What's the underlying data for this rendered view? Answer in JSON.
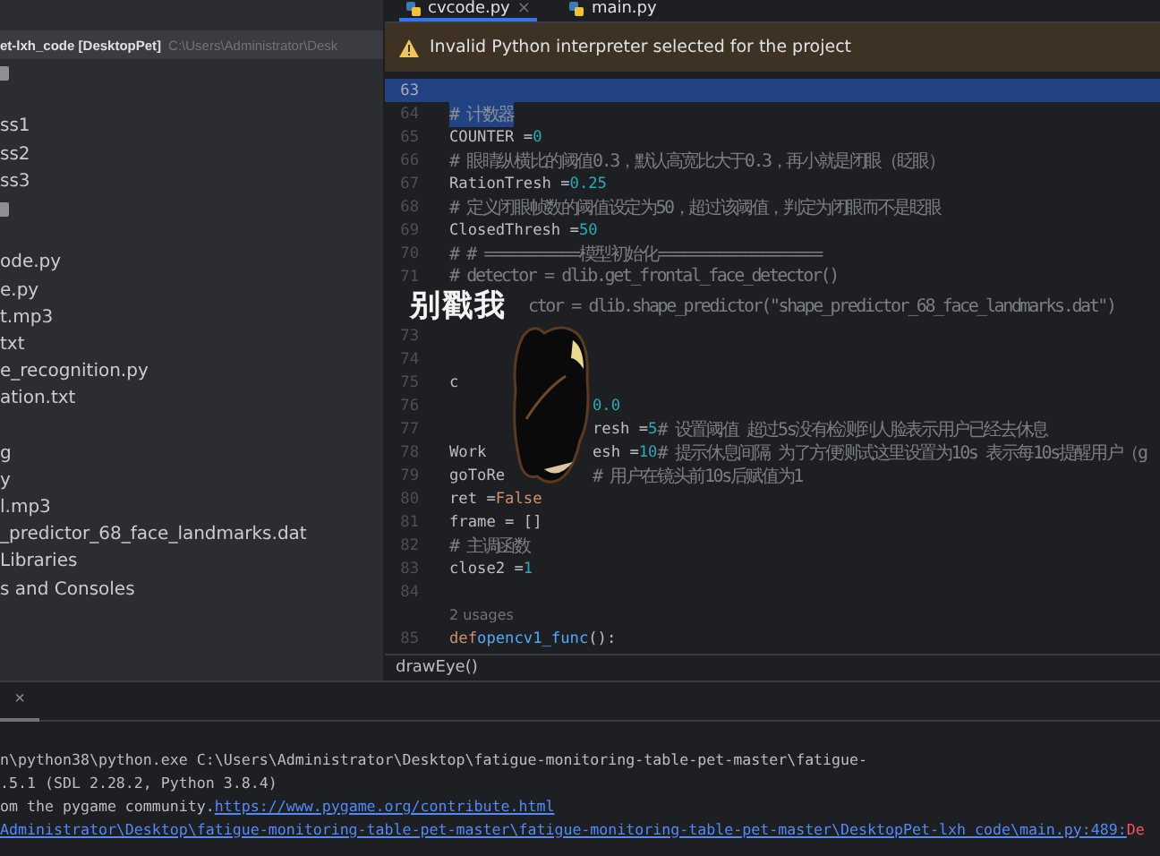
{
  "project": {
    "root": {
      "name": "et-lxh_code",
      "module": "[DesktopPet]",
      "path": "C:\\Users\\Administrator\\Desk"
    },
    "items": [
      {
        "kind": "folder"
      },
      {
        "kind": "blank"
      },
      {
        "label": "ss1",
        "kind": "file"
      },
      {
        "label": "ss2",
        "kind": "file"
      },
      {
        "label": "ss3",
        "kind": "file"
      },
      {
        "kind": "folder"
      },
      {
        "kind": "blank"
      },
      {
        "label": "ode.py",
        "kind": "file"
      },
      {
        "label": "e.py",
        "kind": "file"
      },
      {
        "label": "t.mp3",
        "kind": "file"
      },
      {
        "label": "txt",
        "kind": "file"
      },
      {
        "label": "e_recognition.py",
        "kind": "file"
      },
      {
        "label": "ation.txt",
        "kind": "file"
      },
      {
        "kind": "blank"
      },
      {
        "label": "g",
        "kind": "file"
      },
      {
        "label": "y",
        "kind": "file"
      },
      {
        "label": "l.mp3",
        "kind": "file"
      },
      {
        "label": "_predictor_68_face_landmarks.dat",
        "kind": "file"
      },
      {
        "label": "Libraries",
        "kind": "file"
      },
      {
        "label": "s and Consoles",
        "kind": "file"
      }
    ]
  },
  "tabs": [
    {
      "label": "cvcode.py",
      "selected": true,
      "close": "×"
    },
    {
      "label": "main.py",
      "selected": false
    }
  ],
  "warning": "Invalid Python interpreter selected for the project",
  "lines": [
    {
      "number": "63",
      "kind": "code",
      "highlighted": true
    },
    {
      "number": "64",
      "kind": "code",
      "highlighted": false,
      "segments": [
        {
          "kind": "sel",
          "text": "    # 计数器"
        }
      ]
    },
    {
      "number": "65",
      "kind": "code",
      "highlighted": false,
      "segments": [
        {
          "kind": "plain",
          "text": "COUNTER = "
        },
        {
          "kind": "num",
          "text": "0"
        }
      ]
    },
    {
      "number": "66",
      "kind": "code",
      "highlighted": false,
      "segments": [
        {
          "kind": "comment",
          "text": "# 眼睛纵横比的阈值0.3，默认高宽比大于0.3，再小就是闭眼（眨眼）"
        }
      ]
    },
    {
      "number": "67",
      "kind": "code",
      "highlighted": false,
      "segments": [
        {
          "kind": "plain",
          "text": "RationTresh = "
        },
        {
          "kind": "num",
          "text": "0.25"
        }
      ]
    },
    {
      "number": "68",
      "kind": "code",
      "highlighted": false,
      "segments": [
        {
          "kind": "comment",
          "text": "# 定义闭眼帧数的阈值设定为50，超过该阈值，判定为闭眼而不是眨眼"
        }
      ]
    },
    {
      "number": "69",
      "kind": "code",
      "highlighted": false,
      "segments": [
        {
          "kind": "plain",
          "text": "ClosedThresh = "
        },
        {
          "kind": "num",
          "text": "50"
        }
      ]
    },
    {
      "number": "70",
      "kind": "code",
      "highlighted": false,
      "segments": [
        {
          "kind": "comment",
          "text": "# # ===========模型初始化==================="
        }
      ]
    },
    {
      "number": "71",
      "kind": "code",
      "highlighted": false,
      "segments": [
        {
          "kind": "comment",
          "text": "# detector = dlib.get_frontal_face_detector()"
        }
      ]
    },
    {
      "kind": "captioned",
      "right": [
        {
          "kind": "comment",
          "text": "ctor = dlib.shape_predictor(\"shape_predictor_68_face_landmarks.dat\")"
        }
      ]
    },
    {
      "number": "73",
      "kind": "covered"
    },
    {
      "number": "74",
      "kind": "covered"
    },
    {
      "number": "75",
      "kind": "covered",
      "left": [
        {
          "kind": "plain",
          "text": "c"
        }
      ]
    },
    {
      "number": "76",
      "kind": "covered",
      "right": [
        {
          "kind": "num",
          "text": "0.0"
        }
      ]
    },
    {
      "number": "77",
      "kind": "covered",
      "right": [
        {
          "kind": "plain",
          "text": "resh = "
        },
        {
          "kind": "num",
          "text": "5"
        },
        {
          "kind": "comment",
          "text": "  # 设置阈值 超过5s没有检测到人脸表示用户已经去休息"
        }
      ]
    },
    {
      "number": "78",
      "kind": "covered",
      "left": [
        {
          "kind": "plain",
          "text": "Work"
        }
      ],
      "right": [
        {
          "kind": "plain",
          "text": "esh = "
        },
        {
          "kind": "num",
          "text": "10"
        },
        {
          "kind": "comment",
          "text": "  # 提示休息间隔 为了方便测试这里设置为10s 表示每10s提醒用户（g"
        }
      ]
    },
    {
      "number": "79",
      "kind": "covered",
      "left": [
        {
          "kind": "plain",
          "text": "goToRe"
        }
      ],
      "right": [
        {
          "kind": "comment",
          "text": "# 用户在镜头前10s后赋值为1"
        }
      ]
    },
    {
      "number": "80",
      "kind": "code",
      "highlighted": false,
      "segments": [
        {
          "kind": "plain",
          "text": "ret = "
        },
        {
          "kind": "kw",
          "text": "False"
        }
      ]
    },
    {
      "number": "81",
      "kind": "code",
      "highlighted": false,
      "segments": [
        {
          "kind": "plain",
          "text": "frame = []"
        }
      ]
    },
    {
      "number": "82",
      "kind": "code",
      "highlighted": false,
      "segments": [
        {
          "kind": "comment",
          "text": "# 主调函数"
        }
      ]
    },
    {
      "number": "83",
      "kind": "code",
      "highlighted": false,
      "segments": [
        {
          "kind": "plain",
          "text": "close2 = "
        },
        {
          "kind": "num",
          "text": "1"
        }
      ]
    },
    {
      "number": "84",
      "kind": "code",
      "highlighted": false
    },
    {
      "kind": "hint",
      "text": "2 usages"
    },
    {
      "number": "85",
      "kind": "code",
      "highlighted": false,
      "segments": [
        {
          "kind": "kw",
          "text": "def "
        },
        {
          "kind": "fn",
          "text": "opencv1_func"
        },
        {
          "kind": "plain",
          "text": "():"
        }
      ]
    }
  ],
  "breadcrumb": "drawEye()",
  "pet": {
    "caption": "别戳我"
  },
  "console": {
    "close": "×",
    "lines": [
      [
        {
          "kind": "plain",
          "text": "n\\python38\\python.exe C:\\Users\\Administrator\\Desktop\\fatigue-monitoring-table-pet-master\\fatigue-"
        }
      ],
      [
        {
          "kind": "plain",
          "text": ".5.1 (SDL 2.28.2, Python 3.8.4)"
        }
      ],
      [
        {
          "kind": "plain",
          "text": "om the pygame community. "
        },
        {
          "kind": "link",
          "text": "https://www.pygame.org/contribute.html"
        }
      ],
      [
        {
          "kind": "link",
          "text": "Administrator\\Desktop\\fatigue-monitoring-table-pet-master\\fatigue-monitoring-table-pet-master\\DesktopPet-lxh_code\\main.py:489:"
        },
        {
          "kind": "error",
          "text": " De"
        }
      ]
    ]
  }
}
